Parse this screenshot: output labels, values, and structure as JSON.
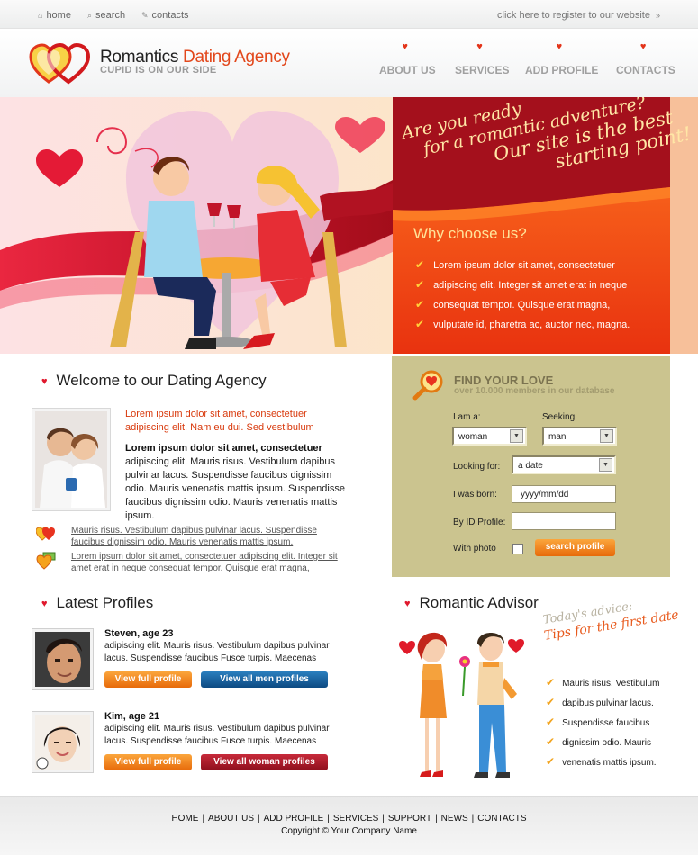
{
  "topbar": {
    "links": [
      {
        "label": "home",
        "icon": "home-icon"
      },
      {
        "label": "search",
        "icon": "search-icon"
      },
      {
        "label": "contacts",
        "icon": "pencil-icon"
      }
    ],
    "register": "click here to register to our website",
    "register_icon": "double-chevron-right-icon"
  },
  "header": {
    "brand_part1": "Romantics",
    "brand_part2": "Dating Agency",
    "slogan": "CUPID IS ON OUR SIDE",
    "nav": [
      "ABOUT US",
      "SERVICES",
      "ADD PROFILE",
      "CONTACTS"
    ]
  },
  "banner": {
    "tagline": [
      "Are you ready",
      "for a romantic adventure?",
      "Our site is the best",
      "starting point!"
    ],
    "why_title": "Why choose us?",
    "why_items": [
      "Lorem ipsum dolor sit amet, consectetuer",
      "adipiscing elit. Integer sit amet erat in neque",
      "consequat tempor. Quisque erat magna,",
      "vulputate id, pharetra ac, auctor nec, magna."
    ]
  },
  "welcome": {
    "title": "Welcome to our Dating Agency",
    "intro": "Lorem ipsum dolor sit amet, consectetuer adipiscing elit. Nam eu dui. Sed vestibulum",
    "bold": "Lorem ipsum dolor sit amet, consectetuer",
    "body": "adipiscing elit. Mauris risus. Vestibulum dapibus pulvinar lacus. Suspendisse faucibus dignissim odio. Mauris venenatis mattis ipsum.  Suspendisse faucibus dignissim odio. Mauris venenatis mattis ipsum.",
    "links": [
      "Mauris risus. Vestibulum dapibus pulvinar lacus. Suspendisse faucibus dignissim odio. Mauris venenatis mattis ipsum.",
      "Lorem ipsum dolor sit amet, consectetuer adipiscing elit. Integer sit amet erat in neque consequat tempor. Quisque erat magna,"
    ]
  },
  "find": {
    "title": "FIND YOUR LOVE",
    "subtitle": "over 10.000 members in our database",
    "i_am_label": "I am a:",
    "i_am_value": "woman",
    "seeking_label": "Seeking:",
    "seeking_value": "man",
    "looking_label": "Looking for:",
    "looking_value": "a date",
    "born_label": "I was born:",
    "born_value": "yyyy/mm/dd",
    "id_label": "By ID Profile:",
    "id_value": "",
    "photo_label": "With photo",
    "search_button": "search profile"
  },
  "profiles": {
    "title": "Latest Profiles",
    "items": [
      {
        "name": "Steven, age 23",
        "text": "adipiscing elit. Mauris risus. Vestibulum dapibus pulvinar lacus. Suspendisse faucibus Fusce turpis. Maecenas",
        "view": "View full profile",
        "all": "View all men profiles"
      },
      {
        "name": "Kim, age 21",
        "text": "adipiscing elit. Mauris risus. Vestibulum dapibus pulvinar lacus. Suspendisse faucibus Fusce turpis. Maecenas",
        "view": "View full profile",
        "all": "View all woman profiles"
      }
    ]
  },
  "advisor": {
    "title": "Romantic Advisor",
    "today": "Today's advice:",
    "tips": "Tips for the first date",
    "items": [
      "Mauris risus. Vestibulum",
      "dapibus pulvinar lacus.",
      "Suspendisse faucibus",
      "dignissim odio. Mauris",
      "venenatis mattis ipsum."
    ]
  },
  "footer": {
    "links": [
      "HOME",
      "ABOUT US",
      "ADD PROFILE",
      "SERVICES",
      "SUPPORT",
      "NEWS",
      "CONTACTS"
    ],
    "copyright": "Copyright © Your Company Name"
  },
  "colors": {
    "accent": "#e2471b",
    "panel": "#cbc48f",
    "banner_red": "#a4101c",
    "banner_orange": "#f04a16"
  }
}
